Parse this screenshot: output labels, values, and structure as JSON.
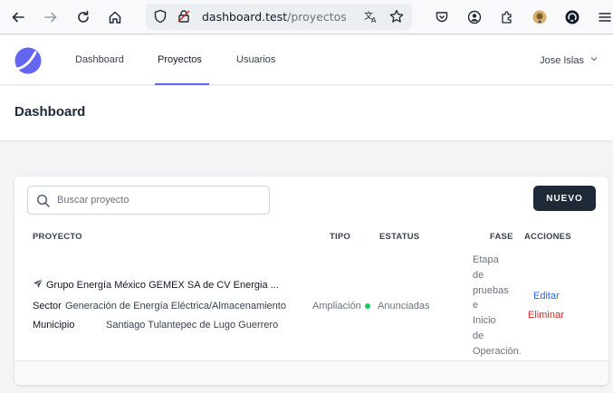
{
  "browser": {
    "url_host": "dashboard.test",
    "url_path": "/proyectos"
  },
  "nav": {
    "links": [
      {
        "label": "Dashboard"
      },
      {
        "label": "Proyectos"
      },
      {
        "label": "Usuarios"
      }
    ],
    "active": "Proyectos",
    "user_name": "Jose Islas",
    "accent_color": "#6366f1"
  },
  "header": {
    "title": "Dashboard"
  },
  "toolbar": {
    "search_placeholder": "Buscar proyecto",
    "new_button_label": "NUEVO"
  },
  "table": {
    "headers": {
      "proyecto": "PROYECTO",
      "tipo": "TIPO",
      "estatus": "ESTATUS",
      "fase": "FASE",
      "acciones": "ACCIONES"
    },
    "rows": [
      {
        "name": "Grupo Energía México GEMEX SA de CV Energia ...",
        "sector_label": "Sector",
        "sector": "Generación de Energía Eléctrica/Almacenamiento",
        "municipio_label": "Municipio",
        "municipio": "Santiago Tulantepec de Lugo Guerrero",
        "tipo": "Ampliación",
        "status": "Anunciadas",
        "status_color": "#22c55e",
        "fase_lines": [
          "Etapa",
          "de",
          "pruebas",
          "e",
          "Inicio",
          "de",
          "Operación."
        ],
        "edit_label": "Editar",
        "delete_label": "Eliminar"
      }
    ]
  }
}
